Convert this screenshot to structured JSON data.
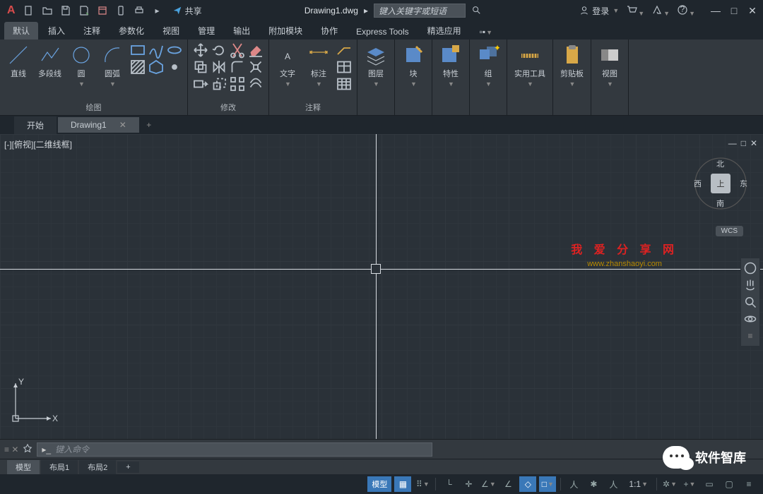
{
  "titlebar": {
    "share": "共享",
    "filename": "Drawing1.dwg",
    "search_placeholder": "键入关键字或短语",
    "login": "登录"
  },
  "ribbon_tabs": [
    "默认",
    "插入",
    "注释",
    "参数化",
    "视图",
    "管理",
    "输出",
    "附加模块",
    "协作",
    "Express Tools",
    "精选应用"
  ],
  "panels": {
    "draw": {
      "title": "绘图",
      "btns": {
        "line": "直线",
        "pline": "多段线",
        "circle": "圆",
        "arc": "圆弧"
      }
    },
    "modify": {
      "title": "修改"
    },
    "annot": {
      "title": "注释",
      "btns": {
        "text": "文字",
        "dim": "标注"
      }
    },
    "layer": "图层",
    "block": "块",
    "prop": "特性",
    "group": "组",
    "util": "实用工具",
    "clip": "剪贴板",
    "view": "视图"
  },
  "doc_tabs": {
    "start": "开始",
    "drawing": "Drawing1"
  },
  "viewport": {
    "label": "[-][俯视][二维线框]"
  },
  "viewcube": {
    "top": "上",
    "n": "北",
    "s": "南",
    "e": "东",
    "w": "西",
    "wcs": "WCS"
  },
  "watermark": {
    "l1": "我 爱 分 享 网",
    "l2": "www.zhanshaoyi.com"
  },
  "cmd": {
    "placeholder": "键入命令"
  },
  "layouts": {
    "model": "模型",
    "l1": "布局1",
    "l2": "布局2"
  },
  "status": {
    "model": "模型",
    "scale": "1:1"
  },
  "wechat": "软件智库"
}
